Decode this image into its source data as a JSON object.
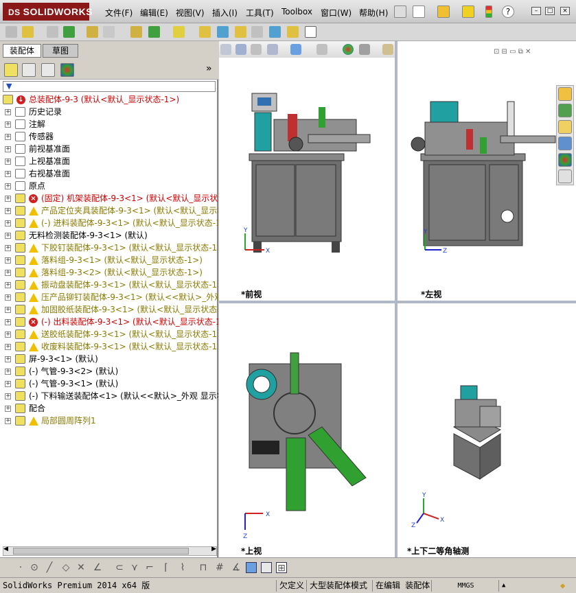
{
  "app": {
    "logo_text": "SOLIDWORKS",
    "logo_prefix": "DS"
  },
  "menu": [
    "文件(F)",
    "编辑(E)",
    "视图(V)",
    "插入(I)",
    "工具(T)",
    "Toolbox",
    "窗口(W)",
    "帮助(H)"
  ],
  "tabs": {
    "assembly": "装配体",
    "sketch": "草图"
  },
  "tree": {
    "root": "总装配体-9-3  (默认<默认_显示状态-1>)",
    "items": [
      {
        "label": "历史记录",
        "status": "",
        "color": "#000000"
      },
      {
        "label": "注解",
        "status": "",
        "color": "#000000"
      },
      {
        "label": "传感器",
        "status": "",
        "color": "#000000"
      },
      {
        "label": "前视基准面",
        "status": "",
        "color": "#000000"
      },
      {
        "label": "上视基准面",
        "status": "",
        "color": "#000000"
      },
      {
        "label": "右视基准面",
        "status": "",
        "color": "#000000"
      },
      {
        "label": "原点",
        "status": "",
        "color": "#000000"
      },
      {
        "label": "(固定) 机架装配体-9-3<1> (默认<默认_显示状态",
        "status": "err",
        "color": "#cc0000"
      },
      {
        "label": "产品定位夹具装配体-9-3<1> (默认<默认_显示状",
        "status": "warn",
        "color": "#8a7a00"
      },
      {
        "label": "(-) 进料装配体-9-3<1> (默认<默认_显示状态-1",
        "status": "warn",
        "color": "#8a7a00"
      },
      {
        "label": "无料检测装配体-9-3<1> (默认)",
        "status": "",
        "color": "#000000"
      },
      {
        "label": "下胶钉装配体-9-3<1> (默认<默认_显示状态-1>)",
        "status": "warn",
        "color": "#8a7a00"
      },
      {
        "label": "落料组-9-3<1> (默认<默认_显示状态-1>)",
        "status": "warn",
        "color": "#8a7a00"
      },
      {
        "label": "落料组-9-3<2> (默认<默认_显示状态-1>)",
        "status": "warn",
        "color": "#8a7a00"
      },
      {
        "label": "振动盘装配体-9-3<1> (默认<默认_显示状态-1>)",
        "status": "warn",
        "color": "#8a7a00"
      },
      {
        "label": "压产品铆钉装配体-9-3<1> (默认<<默认>_外观 显",
        "status": "warn",
        "color": "#8a7a00"
      },
      {
        "label": "加固胶纸装配体-9-3<1> (默认<默认_显示状态-1",
        "status": "warn",
        "color": "#8a7a00"
      },
      {
        "label": "(-) 出料装配体-9-3<1> (默认<默认_显示状态-1",
        "status": "err",
        "color": "#cc0000"
      },
      {
        "label": "送胶纸装配体-9-3<1> (默认<默认_显示状态-1>)",
        "status": "warn",
        "color": "#8a7a00"
      },
      {
        "label": "收废料装配体-9-3<1> (默认<默认_显示状态-1>)",
        "status": "warn",
        "color": "#8a7a00"
      },
      {
        "label": "屏-9-3<1> (默认)",
        "status": "",
        "color": "#000000"
      },
      {
        "label": "(-) 气管-9-3<2> (默认)",
        "status": "",
        "color": "#000000"
      },
      {
        "label": "(-) 气管-9-3<1> (默认)",
        "status": "",
        "color": "#000000"
      },
      {
        "label": "(-) 下料输送装配体<1> (默认<<默认>_外观 显示状",
        "status": "",
        "color": "#000000"
      },
      {
        "label": "配合",
        "status": "",
        "color": "#000000"
      },
      {
        "label": "局部圆周阵列1",
        "status": "warn",
        "color": "#8a7a00"
      }
    ]
  },
  "viewports": {
    "front": "*前视",
    "left": "*左视",
    "top": "*上视",
    "iso": "*上下二等角轴测"
  },
  "axes": {
    "x": "X",
    "y": "Y",
    "z": "Z"
  },
  "status": {
    "product": "SolidWorks Premium 2014 x64 版",
    "underdefined": "欠定义",
    "large_mode": "大型装配体模式",
    "editing": "在编辑 装配体",
    "units": "MMGS"
  },
  "colors": {
    "machine_body": "#6e6e6e",
    "accent": "#20a0a0",
    "error": "#cc0000",
    "warning": "#8a7a00"
  }
}
